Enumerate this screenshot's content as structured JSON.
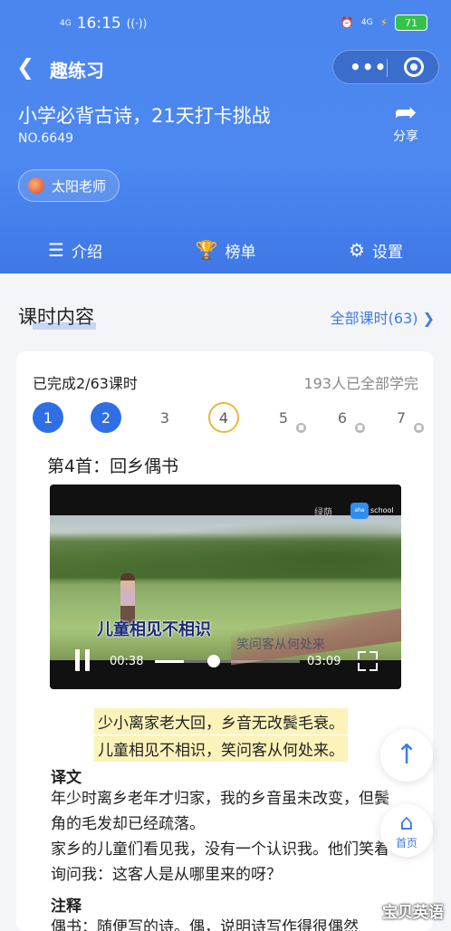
{
  "status_bar": {
    "network_left": "4G",
    "time": "16:15",
    "network_right": "4G",
    "battery": "71"
  },
  "nav": {
    "title": "趣练习",
    "more": "•••"
  },
  "course": {
    "title": "小学必背古诗，21天打卡挑战",
    "number": "NO.6649",
    "share_label": "分享",
    "teacher": "太阳老师"
  },
  "tabs": [
    {
      "label": "介绍",
      "icon": "list-icon"
    },
    {
      "label": "榜单",
      "icon": "trophy-icon"
    },
    {
      "label": "设置",
      "icon": "gear-icon"
    }
  ],
  "section": {
    "title": "课时内容",
    "all_link": "全部课时(63)"
  },
  "card": {
    "progress": "已完成2/63课时",
    "completed_count": "193人已全部学完",
    "lessons": [
      {
        "n": "1",
        "state": "done"
      },
      {
        "n": "2",
        "state": "done"
      },
      {
        "n": "3",
        "state": "open"
      },
      {
        "n": "4",
        "state": "current"
      },
      {
        "n": "5",
        "state": "locked"
      },
      {
        "n": "6",
        "state": "locked"
      },
      {
        "n": "7",
        "state": "locked"
      }
    ],
    "poem_title": "第4首：回乡偶书",
    "video": {
      "watermark": "绿荫",
      "logo_badge": "aha",
      "logo_text": "school",
      "subtitle": "儿童相见不相识",
      "subtitle_faded": "笑问客从何处来",
      "current_time": "00:38",
      "duration": "03:09",
      "progress_fraction": 0.2
    },
    "verses": [
      "少小离家老大回，乡音无改鬓毛衰。",
      "儿童相见不相识，笑问客从何处来。"
    ],
    "translation_label": "译文",
    "translation": [
      "年少时离乡老年才归家，我的乡音虽未改变，但鬓角的毛发却已经疏落。",
      "家乡的儿童们看见我，没有一个认识我。他们笑着询问我：这客人是从哪里来的呀？"
    ],
    "notes_label": "注释",
    "notes_partial": "偶书：随便写的诗。偶，说明诗写作得很偶然"
  },
  "float": {
    "top_glyph": "↑",
    "home_label": "首页"
  },
  "brand": "宝贝英语"
}
